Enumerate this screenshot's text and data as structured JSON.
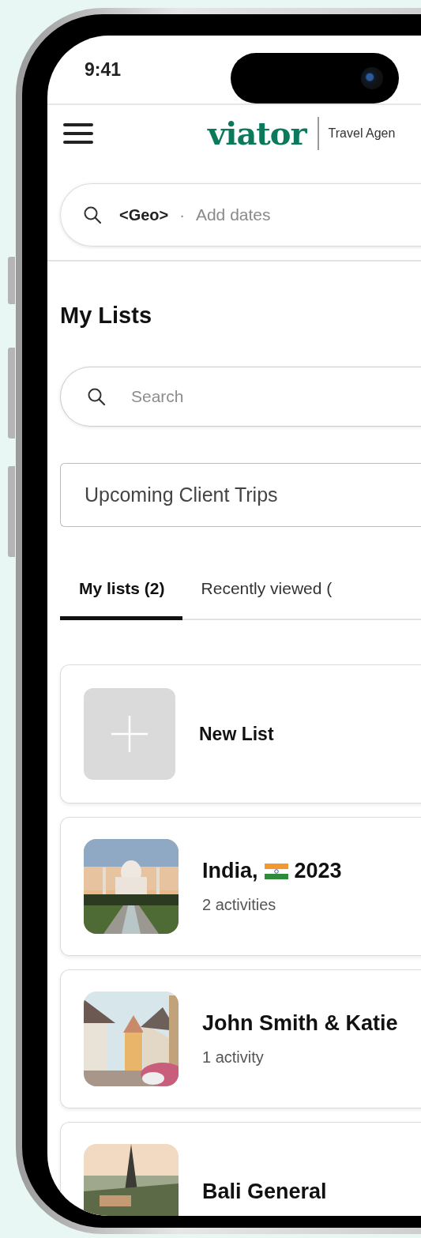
{
  "status_bar": {
    "time": "9:41"
  },
  "header": {
    "logo": "viator",
    "tagline": "Travel Agen"
  },
  "trip_search": {
    "location": "<Geo>",
    "separator": "·",
    "dates_placeholder": "Add dates"
  },
  "page_title": "My Lists",
  "search": {
    "placeholder": "Search"
  },
  "list_filter": {
    "value": "Upcoming Client Trips"
  },
  "tabs": [
    {
      "label": "My lists (2)",
      "selected": true
    },
    {
      "label": "Recently viewed (",
      "selected": false
    }
  ],
  "lists": [
    {
      "kind": "new",
      "title": "New List"
    },
    {
      "kind": "list",
      "title": "India,",
      "flag": true,
      "title_after": "2023",
      "subtitle": "2 activities"
    },
    {
      "kind": "list",
      "title": "John Smith & Katie",
      "subtitle": "1 activity"
    },
    {
      "kind": "list",
      "title": "Bali General"
    }
  ]
}
